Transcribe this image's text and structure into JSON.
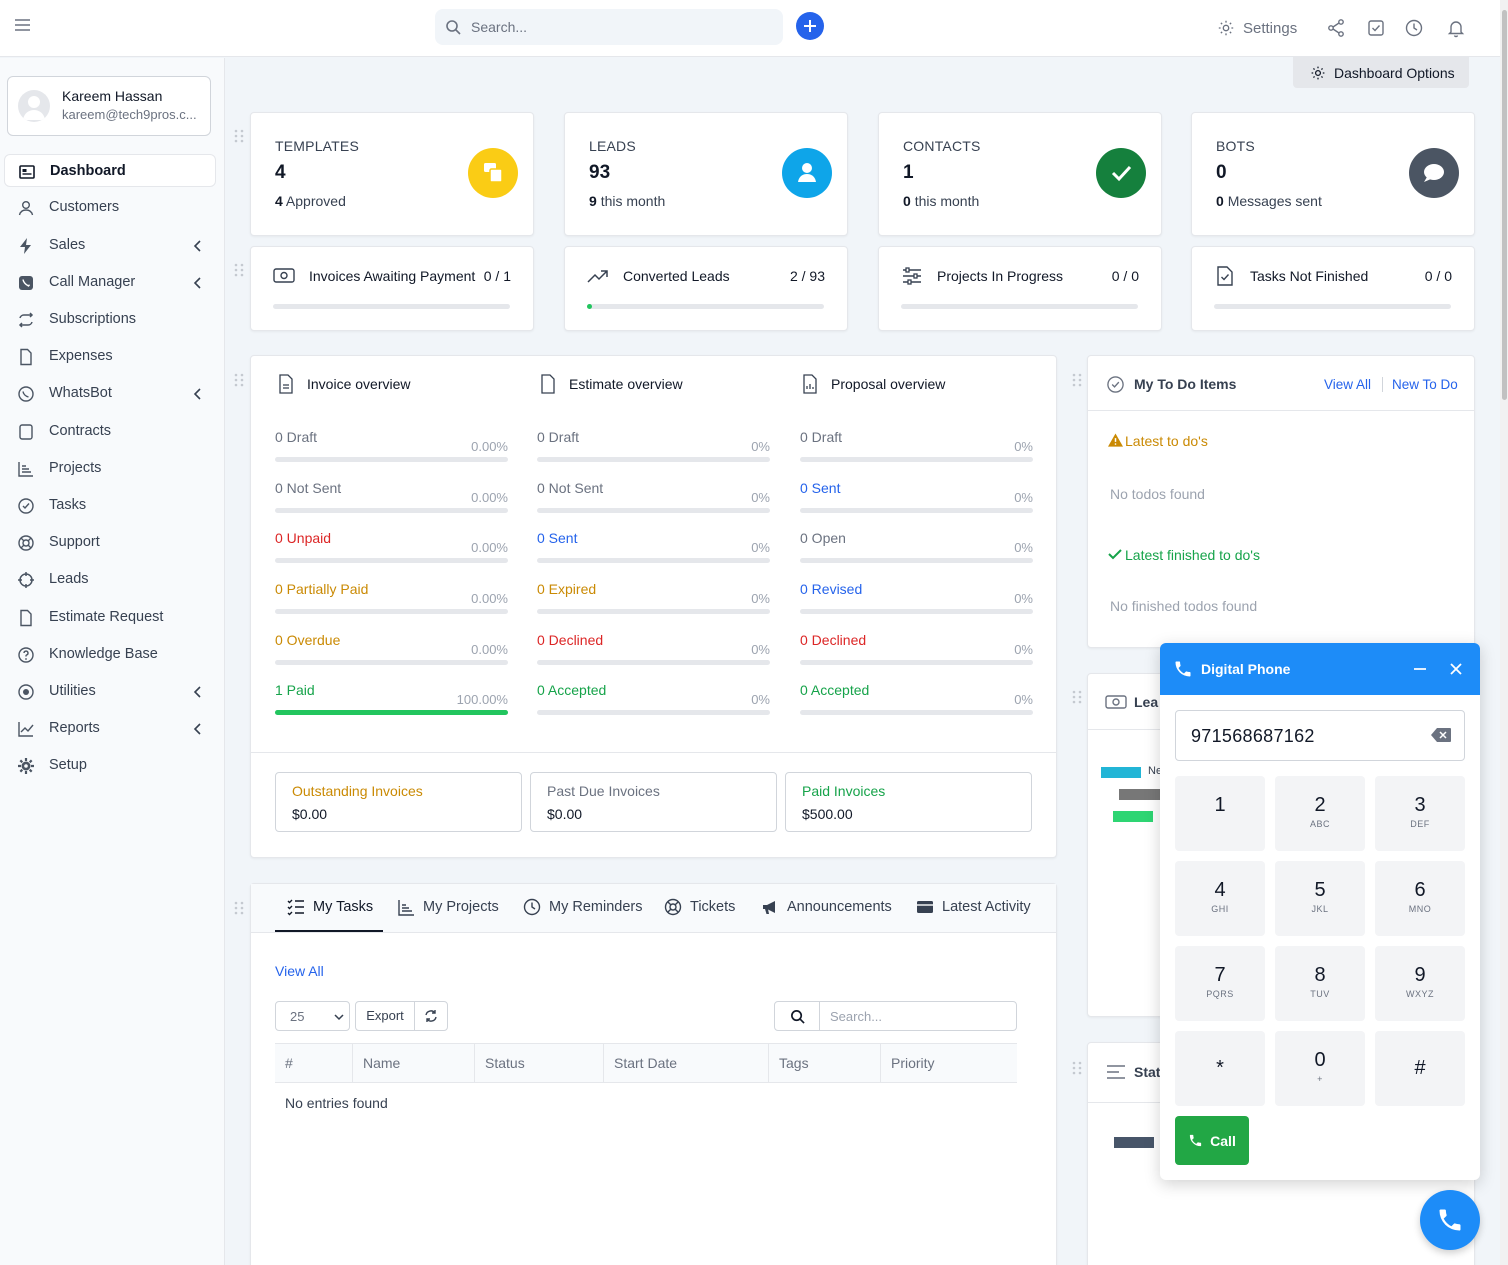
{
  "topbar": {
    "search_placeholder": "Search...",
    "settings_label": "Settings"
  },
  "user": {
    "name": "Kareem Hassan",
    "email": "kareem@tech9pros.c..."
  },
  "sidebar": {
    "items": [
      {
        "label": "Dashboard",
        "icon": "dashboard-icon"
      },
      {
        "label": "Customers",
        "icon": "user-icon"
      },
      {
        "label": "Sales",
        "icon": "bolt-icon"
      },
      {
        "label": "Call Manager",
        "icon": "phone-icon"
      },
      {
        "label": "Subscriptions",
        "icon": "repeat-icon"
      },
      {
        "label": "Expenses",
        "icon": "file-icon"
      },
      {
        "label": "WhatsBot",
        "icon": "whatsapp-icon"
      },
      {
        "label": "Contracts",
        "icon": "contract-icon"
      },
      {
        "label": "Projects",
        "icon": "chart-icon"
      },
      {
        "label": "Tasks",
        "icon": "check-circle-icon"
      },
      {
        "label": "Support",
        "icon": "lifebuoy-icon"
      },
      {
        "label": "Leads",
        "icon": "crosshair-icon"
      },
      {
        "label": "Estimate Request",
        "icon": "file-icon"
      },
      {
        "label": "Knowledge Base",
        "icon": "question-icon"
      },
      {
        "label": "Utilities",
        "icon": "dot-circle-icon"
      },
      {
        "label": "Reports",
        "icon": "line-chart-icon"
      },
      {
        "label": "Setup",
        "icon": "gear-icon"
      }
    ]
  },
  "dashboard_options_label": "Dashboard Options",
  "stats": [
    {
      "label": "TEMPLATES",
      "value": "4",
      "sub_count": "4",
      "sub_text": "Approved",
      "color": "#facc15"
    },
    {
      "label": "LEADS",
      "value": "93",
      "sub_count": "9",
      "sub_text": "this month",
      "color": "#0ea5e9"
    },
    {
      "label": "CONTACTS",
      "value": "1",
      "sub_count": "0",
      "sub_text": "this month",
      "color": "#15803d"
    },
    {
      "label": "BOTS",
      "value": "0",
      "sub_count": "0",
      "sub_text": "Messages sent",
      "color": "#4b5563"
    }
  ],
  "progress_cards": [
    {
      "label": "Invoices Awaiting Payment",
      "value": "0 / 1",
      "fill": 0
    },
    {
      "label": "Converted Leads",
      "value": "2 / 93",
      "fill": 0.0215
    },
    {
      "label": "Projects In Progress",
      "value": "0 / 0",
      "fill": 0
    },
    {
      "label": "Tasks Not Finished",
      "value": "0 / 0",
      "fill": 0
    }
  ],
  "overview": {
    "invoice": {
      "title": "Invoice overview",
      "rows": [
        {
          "label": "0 Draft",
          "pct": "0.00%",
          "fill": 0,
          "tone": "gray"
        },
        {
          "label": "0 Not Sent",
          "pct": "0.00%",
          "fill": 0,
          "tone": "gray"
        },
        {
          "label": "0 Unpaid",
          "pct": "0.00%",
          "fill": 0,
          "tone": "red"
        },
        {
          "label": "0 Partially Paid",
          "pct": "0.00%",
          "fill": 0,
          "tone": "yellow"
        },
        {
          "label": "0 Overdue",
          "pct": "0.00%",
          "fill": 0,
          "tone": "yellow"
        },
        {
          "label": "1 Paid",
          "pct": "100.00%",
          "fill": 1,
          "tone": "green"
        }
      ]
    },
    "estimate": {
      "title": "Estimate overview",
      "rows": [
        {
          "label": "0 Draft",
          "pct": "0%",
          "fill": 0,
          "tone": "gray"
        },
        {
          "label": "0 Not Sent",
          "pct": "0%",
          "fill": 0,
          "tone": "gray"
        },
        {
          "label": "0 Sent",
          "pct": "0%",
          "fill": 0,
          "tone": "blue"
        },
        {
          "label": "0 Expired",
          "pct": "0%",
          "fill": 0,
          "tone": "yellow"
        },
        {
          "label": "0 Declined",
          "pct": "0%",
          "fill": 0,
          "tone": "red"
        },
        {
          "label": "0 Accepted",
          "pct": "0%",
          "fill": 0,
          "tone": "green"
        }
      ]
    },
    "proposal": {
      "title": "Proposal overview",
      "rows": [
        {
          "label": "0 Draft",
          "pct": "0%",
          "fill": 0,
          "tone": "gray"
        },
        {
          "label": "0 Sent",
          "pct": "0%",
          "fill": 0,
          "tone": "blue"
        },
        {
          "label": "0 Open",
          "pct": "0%",
          "fill": 0,
          "tone": "gray"
        },
        {
          "label": "0 Revised",
          "pct": "0%",
          "fill": 0,
          "tone": "blue"
        },
        {
          "label": "0 Declined",
          "pct": "0%",
          "fill": 0,
          "tone": "red"
        },
        {
          "label": "0 Accepted",
          "pct": "0%",
          "fill": 0,
          "tone": "green"
        }
      ]
    },
    "summary": [
      {
        "label": "Outstanding Invoices",
        "value": "$0.00",
        "color": "#ca8a04"
      },
      {
        "label": "Past Due Invoices",
        "value": "$0.00",
        "color": "#6b7280"
      },
      {
        "label": "Paid Invoices",
        "value": "$500.00",
        "color": "#16a34a"
      }
    ]
  },
  "tabs": {
    "items": [
      "My Tasks",
      "My Projects",
      "My Reminders",
      "Tickets",
      "Announcements",
      "Latest Activity"
    ],
    "view_all": "View All",
    "page_size": "25",
    "export": "Export",
    "search_placeholder": "Search...",
    "columns": [
      "#",
      "Name",
      "Status",
      "Start Date",
      "Tags",
      "Priority"
    ],
    "empty": "No entries found"
  },
  "todo": {
    "title": "My To Do Items",
    "view_all": "View All",
    "new_todo": "New To Do",
    "latest_heading": "Latest to do's",
    "latest_empty": "No todos found",
    "finished_heading": "Latest finished to do's",
    "finished_empty": "No finished todos found"
  },
  "partial_panels": {
    "leads_title": "Lea",
    "leads_legend": "Ne",
    "stats_title": "Stat"
  },
  "phone": {
    "title": "Digital Phone",
    "number": "971568687162",
    "keys": [
      {
        "d": "1",
        "l": ""
      },
      {
        "d": "2",
        "l": "ABC"
      },
      {
        "d": "3",
        "l": "DEF"
      },
      {
        "d": "4",
        "l": "GHI"
      },
      {
        "d": "5",
        "l": "JKL"
      },
      {
        "d": "6",
        "l": "MNO"
      },
      {
        "d": "7",
        "l": "PQRS"
      },
      {
        "d": "8",
        "l": "TUV"
      },
      {
        "d": "9",
        "l": "WXYZ"
      },
      {
        "d": "*",
        "l": ""
      },
      {
        "d": "0",
        "l": "+"
      },
      {
        "d": "#",
        "l": ""
      }
    ],
    "call_label": "Call"
  }
}
